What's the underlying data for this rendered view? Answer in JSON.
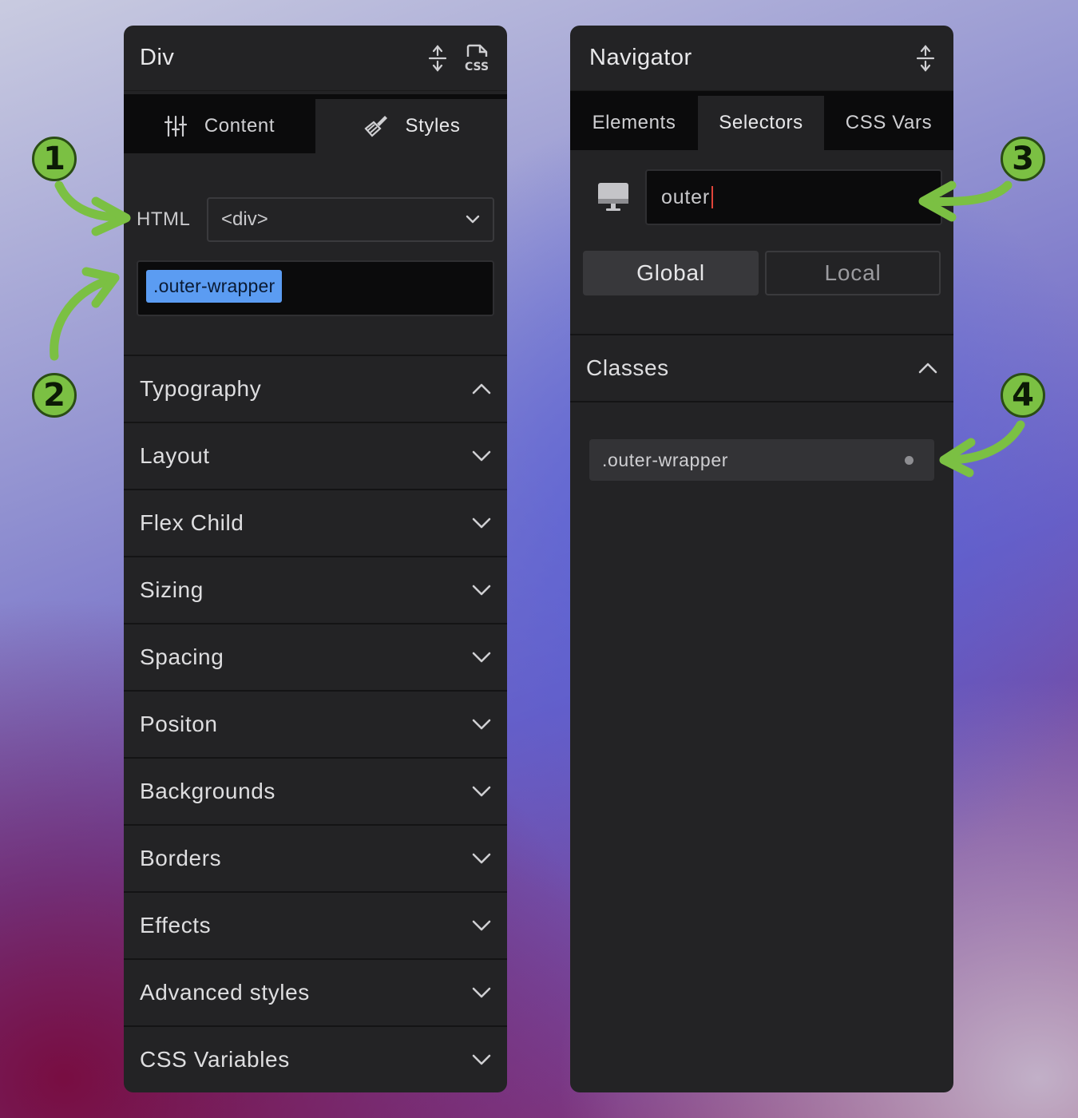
{
  "left_panel": {
    "title": "Div",
    "tabs": [
      {
        "label": "Content",
        "icon": "sliders-icon",
        "active": false
      },
      {
        "label": "Styles",
        "icon": "brush-icon",
        "active": true
      }
    ],
    "html_label": "HTML",
    "html_tag": "<div>",
    "class_chip": ".outer-wrapper",
    "sections": [
      "Typography",
      "Layout",
      "Flex Child",
      "Sizing",
      "Spacing",
      "Positon",
      "Backgrounds",
      "Borders",
      "Effects",
      "Advanced styles",
      "CSS Variables"
    ]
  },
  "right_panel": {
    "title": "Navigator",
    "tabs": [
      {
        "label": "Elements",
        "active": false
      },
      {
        "label": "Selectors",
        "active": true
      },
      {
        "label": "CSS Vars",
        "active": false
      }
    ],
    "search_value": "outer",
    "scope": {
      "global": "Global",
      "local": "Local",
      "selected": "Global"
    },
    "classes_header": "Classes",
    "classes": [
      ".outer-wrapper"
    ]
  },
  "annotations": [
    "1",
    "2",
    "3",
    "4"
  ],
  "colors": {
    "panel_bg": "#232325",
    "chip_bg": "#5b9cf2",
    "annotation_green": "#7bc043"
  }
}
